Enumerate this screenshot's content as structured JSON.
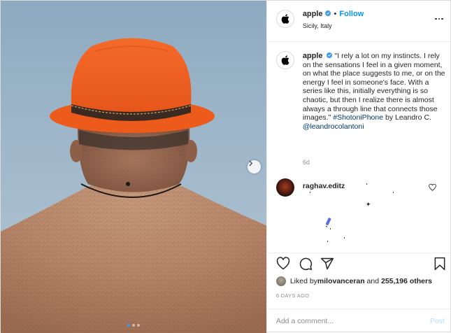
{
  "header": {
    "username": "apple",
    "separator": "•",
    "follow_label": "Follow",
    "location": "Sicily, Italy",
    "more_icon": "more-horizontal-icon"
  },
  "caption": {
    "username": "apple",
    "text_part1": "\"I rely a lot on my instincts. I rely on the sensations I feel in a given moment, on what the place suggests to me, or on the energy I feel in someone's face. With a series like this, initially everything is so chaotic, but then I realize there is almost always a through line that connects those images.\" ",
    "hashtag": "#ShotoniPhone",
    "text_part2": " by Leandro C. ",
    "mention": "@leandrocolantoni",
    "age": "6d"
  },
  "comment": {
    "username": "raghav.editz",
    "body_glyph": "✦"
  },
  "likes": {
    "prefix": "Liked by ",
    "user": "milovanceran",
    "mid": " and ",
    "count": "255,196 others"
  },
  "date": "6 DAYS AGO",
  "add_comment": {
    "placeholder": "Add a comment...",
    "post_label": "Post"
  },
  "carousel": {
    "slide_count": 3,
    "active_index": 0
  },
  "colors": {
    "link_blue": "#0095f6",
    "hashtag_blue": "#00376b",
    "hat_orange": "#f0601f",
    "sky": "#9fb8cc"
  }
}
